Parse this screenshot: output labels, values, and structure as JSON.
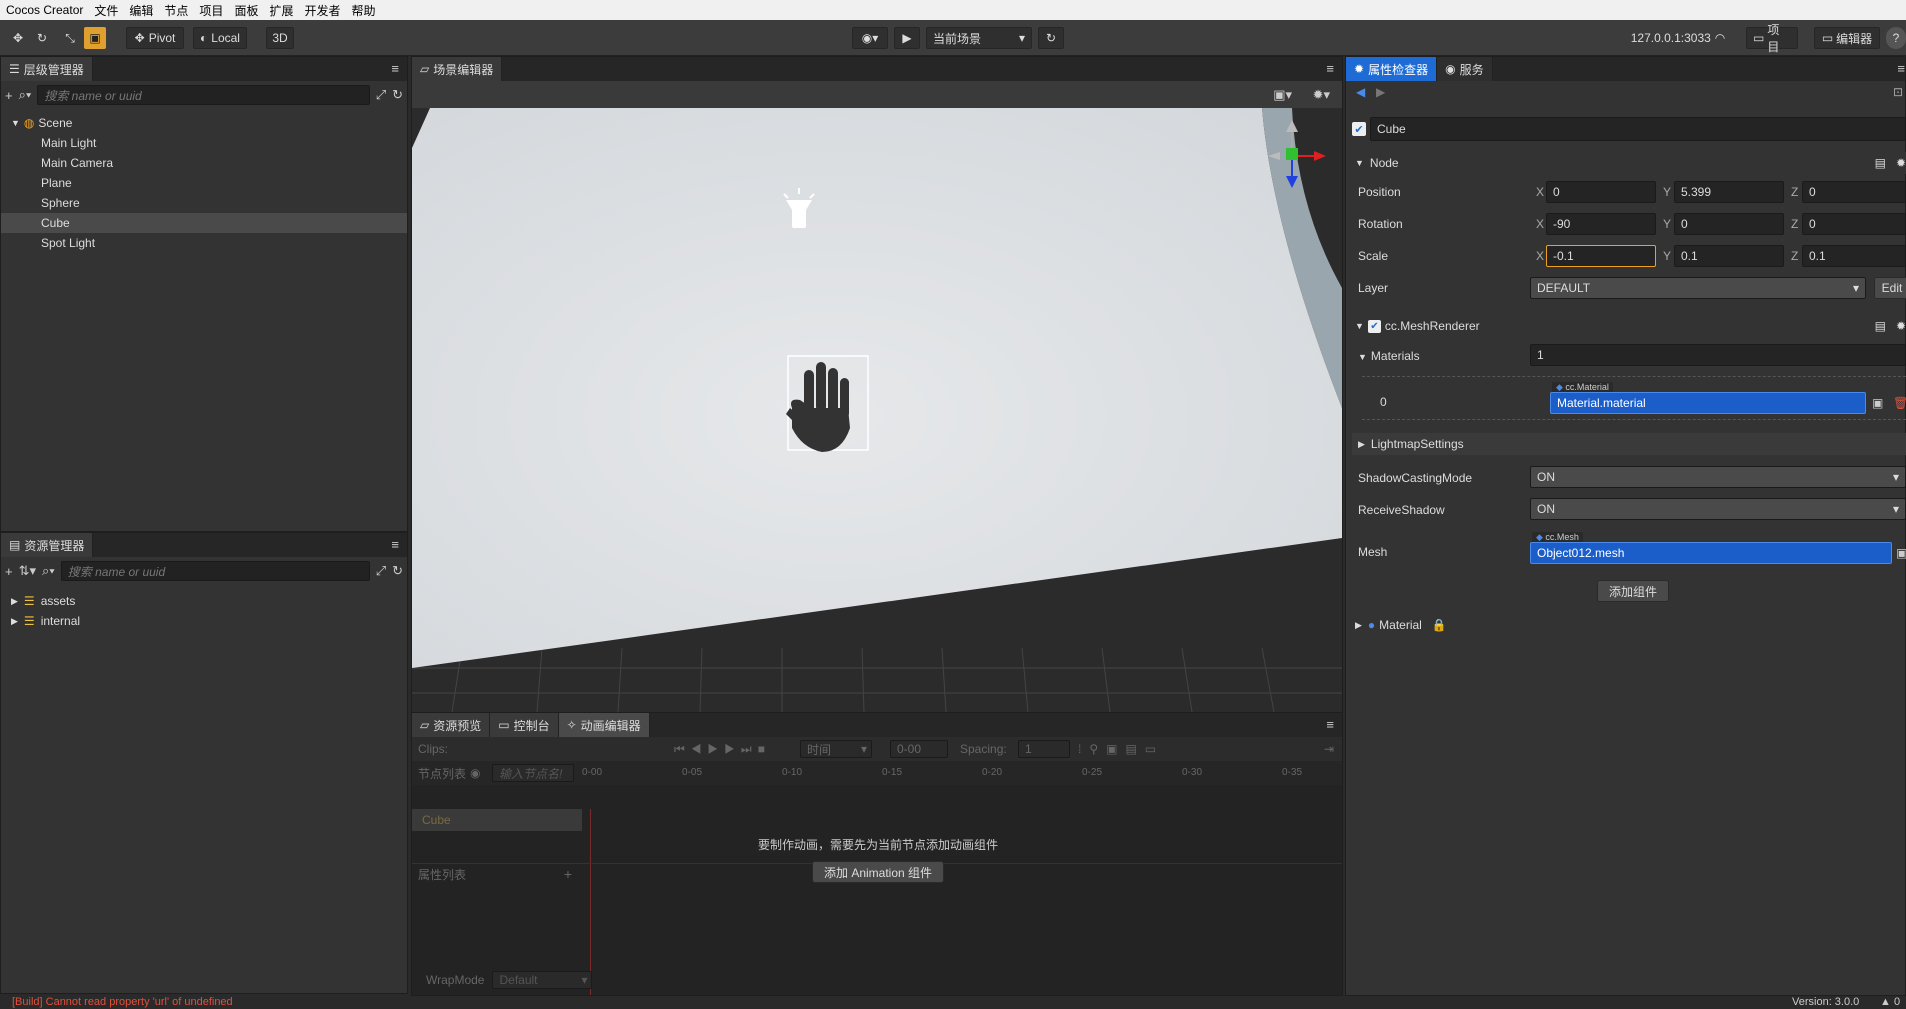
{
  "menubar": {
    "app": "Cocos Creator",
    "items": [
      "文件",
      "编辑",
      "节点",
      "项目",
      "面板",
      "扩展",
      "开发者",
      "帮助"
    ]
  },
  "toolbar": {
    "pivot": "Pivot",
    "local": "Local",
    "mode3d": "3D",
    "scene_select": "当前场景",
    "ip": "127.0.0.1:3033",
    "project_btn": "项目",
    "editor_btn": "编辑器",
    "help": "?"
  },
  "hierarchy": {
    "title": "层级管理器",
    "search_placeholder": "搜索 name or uuid",
    "root": "Scene",
    "nodes": [
      "Main Light",
      "Main Camera",
      "Plane",
      "Sphere",
      "Cube",
      "Spot Light"
    ],
    "selected": "Cube"
  },
  "assets": {
    "title": "资源管理器",
    "search_placeholder": "搜索 name or uuid",
    "items": [
      "assets",
      "internal"
    ]
  },
  "scene": {
    "title": "场景编辑器"
  },
  "bottom": {
    "tabs": [
      "资源预览",
      "控制台",
      "动画编辑器"
    ],
    "clips_label": "Clips:",
    "time_select": "时间",
    "time_value": "0-00",
    "spacing_label": "Spacing:",
    "spacing_value": "1",
    "node_list_label": "节点列表",
    "node_filter_placeholder": "输入节点名!",
    "timeline_ticks": [
      "0-00",
      "0-05",
      "0-10",
      "0-15",
      "0-20",
      "0-25",
      "0-30",
      "0-35"
    ],
    "node_row": "Cube",
    "message": "要制作动画，需要先为当前节点添加动画组件",
    "add_button": "添加 Animation 组件",
    "prop_list_label": "属性列表",
    "wrapmode_label": "WrapMode",
    "wrapmode_value": "Default"
  },
  "inspector": {
    "tabs": [
      "属性检查器",
      "服务"
    ],
    "node_name": "Cube",
    "node_section": "Node",
    "position": {
      "label": "Position",
      "x": "0",
      "y": "5.399",
      "z": "0"
    },
    "rotation": {
      "label": "Rotation",
      "x": "-90",
      "y": "0",
      "z": "0"
    },
    "scale": {
      "label": "Scale",
      "x": "-0.1",
      "y": "0.1",
      "z": "0.1"
    },
    "layer": {
      "label": "Layer",
      "value": "DEFAULT",
      "edit": "Edit"
    },
    "mesh_renderer": "cc.MeshRenderer",
    "materials": {
      "label": "Materials",
      "count": "1",
      "index": "0",
      "type": "cc.Material",
      "value": "Material.material"
    },
    "lightmap": "LightmapSettings",
    "shadow_casting": {
      "label": "ShadowCastingMode",
      "value": "ON"
    },
    "receive_shadow": {
      "label": "ReceiveShadow",
      "value": "ON"
    },
    "mesh": {
      "label": "Mesh",
      "type": "cc.Mesh",
      "value": "Object012.mesh"
    },
    "add_component": "添加组件",
    "material_section": "Material",
    "axis": {
      "x": "X",
      "y": "Y",
      "z": "Z"
    }
  },
  "status": {
    "error": "[Build] Cannot read property 'url' of undefined",
    "version": "Version: 3.0.0",
    "count": "0"
  },
  "colors": {
    "accent": "#1e6bd6",
    "selection_blue": "#1b5ec9",
    "error_red": "#e0503c",
    "orange": "#f0a020"
  }
}
